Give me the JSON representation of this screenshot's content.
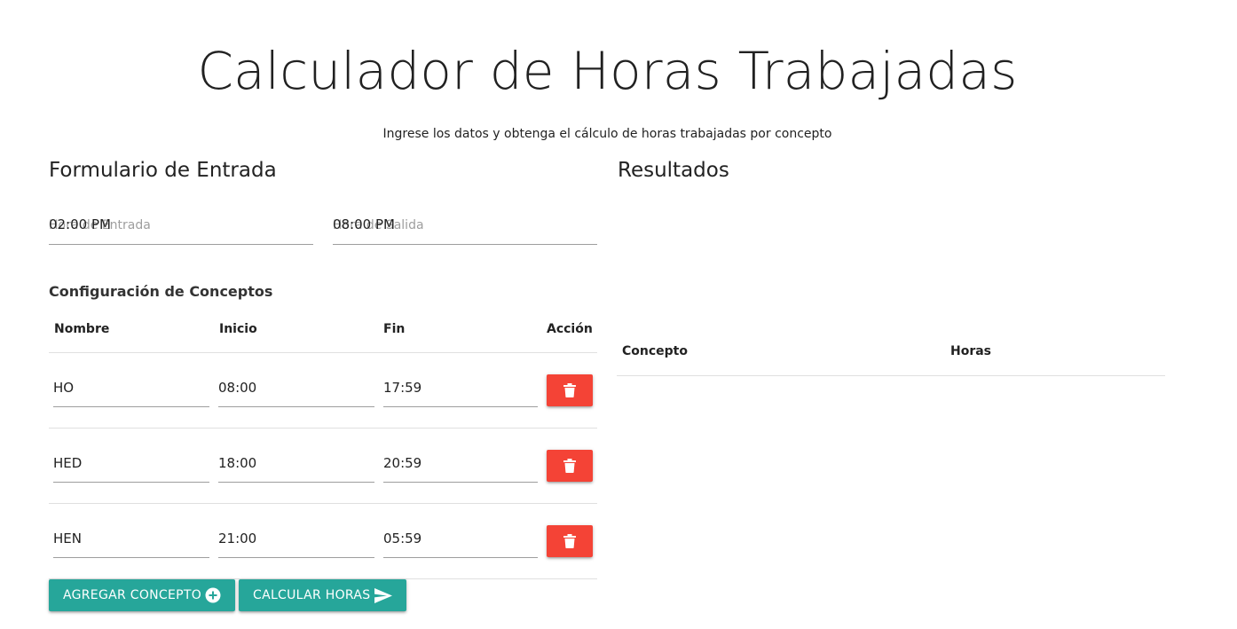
{
  "header": {
    "title": "Calculador de Horas Trabajadas",
    "subtitle": "Ingrese los datos y obtenga el cálculo de horas trabajadas por concepto"
  },
  "form": {
    "title": "Formulario de Entrada",
    "entry": {
      "placeholder": "Hora de Entrada",
      "value": "02:00 PM"
    },
    "exit": {
      "placeholder": "Hora de Salida",
      "value": "08:00 PM"
    },
    "concepts_heading": "Configuración de Conceptos",
    "columns": [
      "Nombre",
      "Inicio",
      "Fin",
      "Acción"
    ],
    "rows": [
      {
        "name": "HO",
        "start": "08:00",
        "end": "17:59"
      },
      {
        "name": "HED",
        "start": "18:00",
        "end": "20:59"
      },
      {
        "name": "HEN",
        "start": "21:00",
        "end": "05:59"
      }
    ],
    "delete_icon": "trash-icon",
    "add_button": {
      "label": "AGREGAR CONCEPTO",
      "icon": "add-circle-icon"
    },
    "calc_button": {
      "label": "CALCULAR HORAS",
      "icon": "send-icon"
    }
  },
  "results": {
    "title": "Resultados",
    "columns": [
      "Concepto",
      "Horas"
    ]
  },
  "colors": {
    "accent": "#26a69a",
    "danger": "#f44336"
  }
}
